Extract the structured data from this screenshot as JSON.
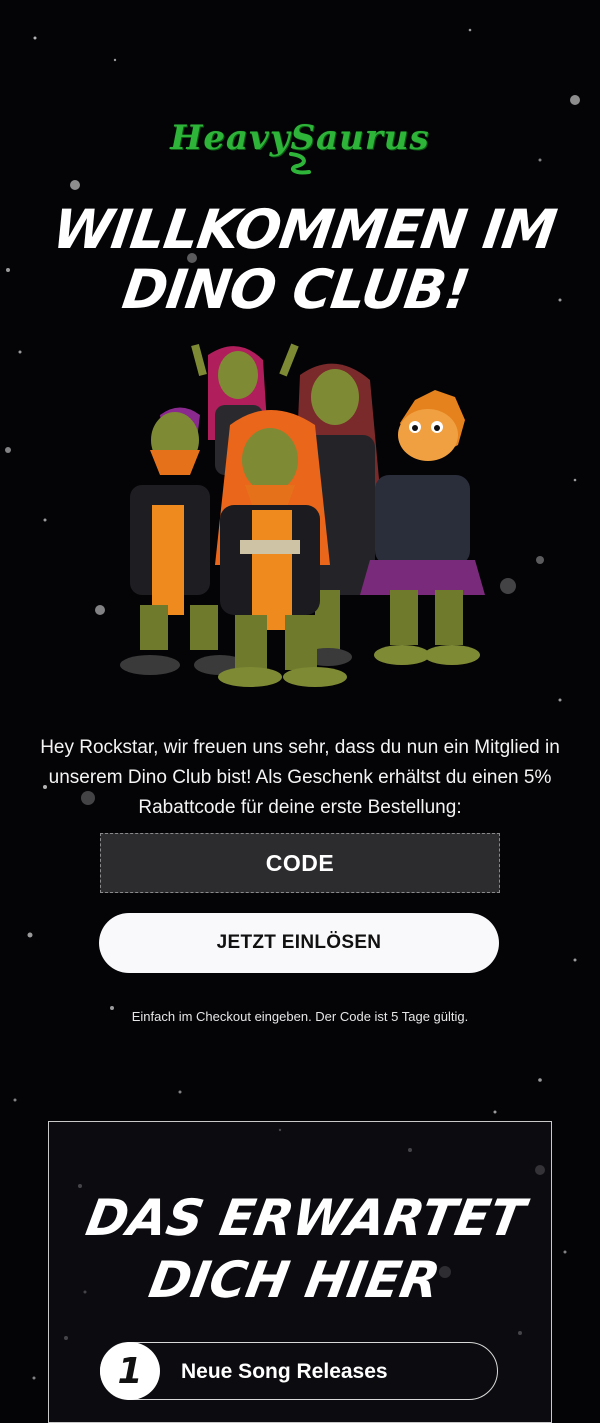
{
  "brand": {
    "logo_text": "HeavySaurus",
    "colors": {
      "background": "#040306",
      "logo_green": "#2fb43a",
      "button_bg": "#f9f8fa",
      "code_bg": "#2c2b2e"
    }
  },
  "hero": {
    "headline_line1": "Willkommen im",
    "headline_line2": "Dino Club!",
    "image_alt": "dino-band-photo"
  },
  "intro": {
    "text": "Hey Rockstar, wir freuen uns sehr, dass du nun ein Mitglied in unserem Dino Club bist! Als Geschenk erhältst du einen 5% Rabattcode für deine erste Bestellung:"
  },
  "coupon": {
    "code": "CODE",
    "button_label": "JETZT EINLÖSEN",
    "note": "Einfach im Checkout eingeben. Der Code ist 5 Tage gültig."
  },
  "features": {
    "title_line1": "Das erwartet",
    "title_line2": "dich hier",
    "items": [
      {
        "number": "1",
        "label": "Neue Song Releases"
      }
    ]
  }
}
